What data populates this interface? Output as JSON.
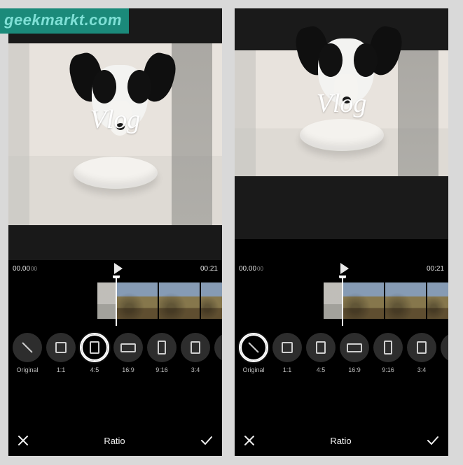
{
  "watermark": {
    "text": "geekmarkt.com"
  },
  "overlayText": "Vlog",
  "panelTitle": "Ratio",
  "screens": {
    "left": {
      "timeStart": "00.00",
      "timeStartSuffix": "00",
      "timeEnd": "00:21",
      "selectedRatioIndex": 2,
      "ratios": [
        {
          "label": "Original",
          "glyph": "g-orig"
        },
        {
          "label": "1:1",
          "glyph": "g-1-1"
        },
        {
          "label": "4:5",
          "glyph": "g-4-5"
        },
        {
          "label": "16:9",
          "glyph": "g-16-9"
        },
        {
          "label": "9:16",
          "glyph": "g-9-16"
        },
        {
          "label": "3:4",
          "glyph": "g-3-4"
        },
        {
          "label": "",
          "glyph": "g-extra"
        }
      ]
    },
    "right": {
      "timeStart": "00.00",
      "timeStartSuffix": "00",
      "timeEnd": "00:21",
      "selectedRatioIndex": 0,
      "ratios": [
        {
          "label": "Original",
          "glyph": "g-orig"
        },
        {
          "label": "1:1",
          "glyph": "g-1-1"
        },
        {
          "label": "4:5",
          "glyph": "g-4-5"
        },
        {
          "label": "16:9",
          "glyph": "g-16-9"
        },
        {
          "label": "9:16",
          "glyph": "g-9-16"
        },
        {
          "label": "3:4",
          "glyph": "g-3-4"
        },
        {
          "label": "",
          "glyph": "g-extra"
        }
      ]
    }
  }
}
